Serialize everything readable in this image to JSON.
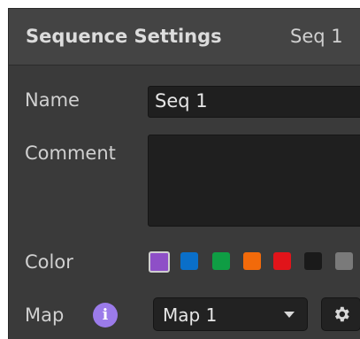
{
  "header": {
    "title": "Sequence Settings",
    "sequence_name": "Seq 1"
  },
  "fields": {
    "name_label": "Name",
    "name_value": "Seq 1",
    "comment_label": "Comment",
    "comment_value": "",
    "color_label": "Color",
    "map_label": "Map",
    "map_info_glyph": "i",
    "map_value": "Map 1"
  },
  "colors": {
    "swatches": [
      "#8e4fc7",
      "#0a6fc9",
      "#0f9d44",
      "#f26a0a",
      "#e1141a",
      "#1a1a1a",
      "#7a7a7a"
    ],
    "selected_index": 0
  },
  "icons": {
    "map_info": "info-icon",
    "map_dropdown": "chevron-down-icon",
    "map_settings": "gear-icon"
  }
}
